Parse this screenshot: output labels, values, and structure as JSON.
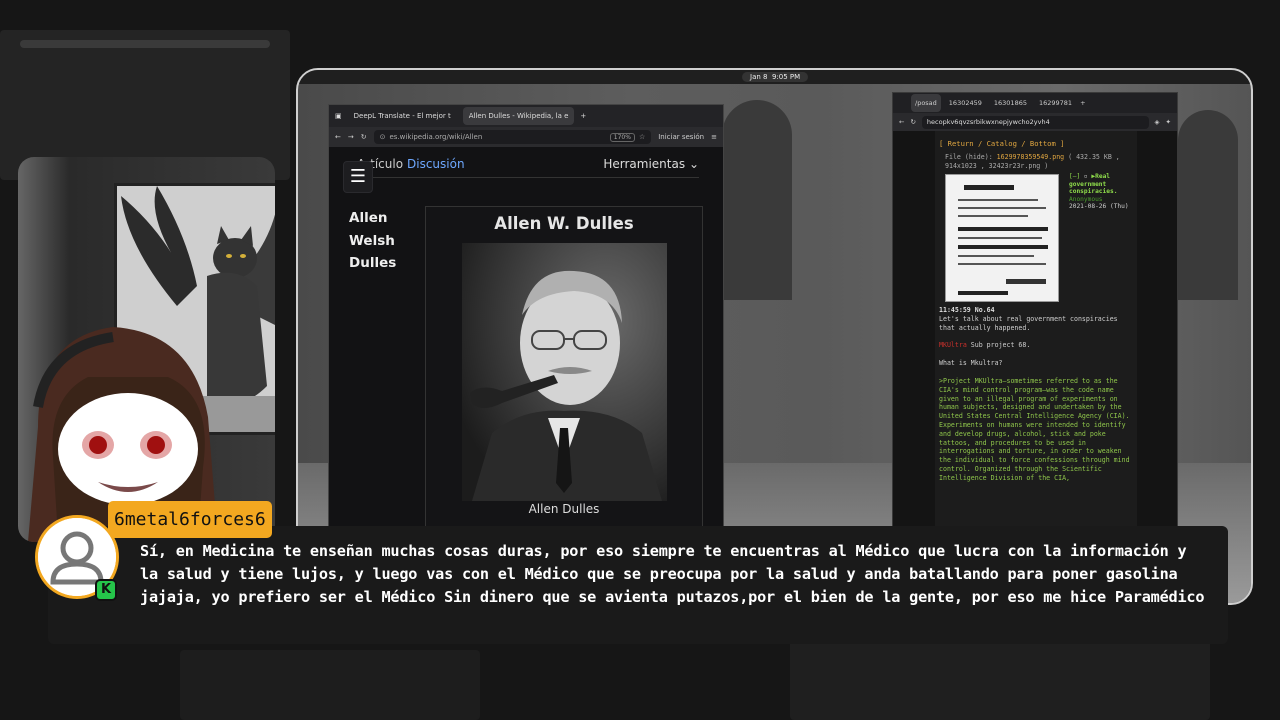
{
  "system": {
    "date": "Jan 8",
    "time": "9:05 PM"
  },
  "left_browser": {
    "tabs": [
      {
        "label": "DeepL Translate - El mejor t",
        "active": false
      },
      {
        "label": "Allen Dulles - Wikipedia, la e",
        "active": true
      }
    ],
    "new_tab_symbol": "+",
    "url": "es.wikipedia.org/wiki/Allen",
    "zoom": "170%",
    "signin_label": "Iniciar sesión",
    "menu_symbol": "≡"
  },
  "wiki": {
    "tab_article": "Artículo",
    "tab_discussion": "Discusión",
    "tools_label": "Herramientas",
    "toc_symbol": "☰",
    "name_lines": [
      "Allen",
      "Welsh",
      "Dulles"
    ],
    "infobox_title": "Allen W. Dulles",
    "photo_caption": "Allen Dulles"
  },
  "right_browser": {
    "tabs": [
      {
        "label": "/posad",
        "active": true
      },
      {
        "label": "16302459",
        "active": false
      },
      {
        "label": "16301865",
        "active": false
      },
      {
        "label": "16299781",
        "active": false
      }
    ],
    "new_tab_symbol": "+",
    "url": "hecopkv6qvzsrbikwxnepjywcho2yvh4",
    "board_nav": "[ Return / Catalog / Bottom ]",
    "file_label": "File",
    "file_hide": "(hide):",
    "file_name": "1629978359549.png",
    "file_info": "( 432.35 KB , 914x1023 , 32423r23r.png )",
    "post_controls": "[–]",
    "post_subject": "Real government conspiracies.",
    "post_author": "Anonymous",
    "post_date": "2021-08-26 (Thu)",
    "post_time": "11:45:59 No.64",
    "body_intro": "Let's talk about real government conspiracies that actually happened.",
    "body_flag": "MKUltra",
    "body_flag_text": "Sub project 68.",
    "body_question": "What is Mkultra?",
    "body_quote": ">Project MKUltra—sometimes referred to as the CIA's mind control program—was the code name given to an illegal program of experiments on human subjects, designed and undertaken by the United States Central Intelligence Agency (CIA). Experiments on humans were intended to identify and develop drugs, alcohol, stick and poke tattoos, and procedures to be used in interrogations and torture, in order to weaken the individual to force confessions through mind control. Organized through the Scientific Intelligence Division of the CIA,"
  },
  "chat": {
    "username": "6metal6forces6",
    "badge_symbol": "K",
    "message": "Sí, en Medicina te enseñan muchas cosas duras, por eso siempre te encuentras al Médico que lucra con la información y la salud y tiene lujos, y luego vas con el Médico que se preocupa por la salud y anda batallando para poner gasolina jajaja, yo prefiero ser el Médico Sin dinero que se avienta putazos,por el bien de la gente, por eso me hice Paramédico"
  }
}
